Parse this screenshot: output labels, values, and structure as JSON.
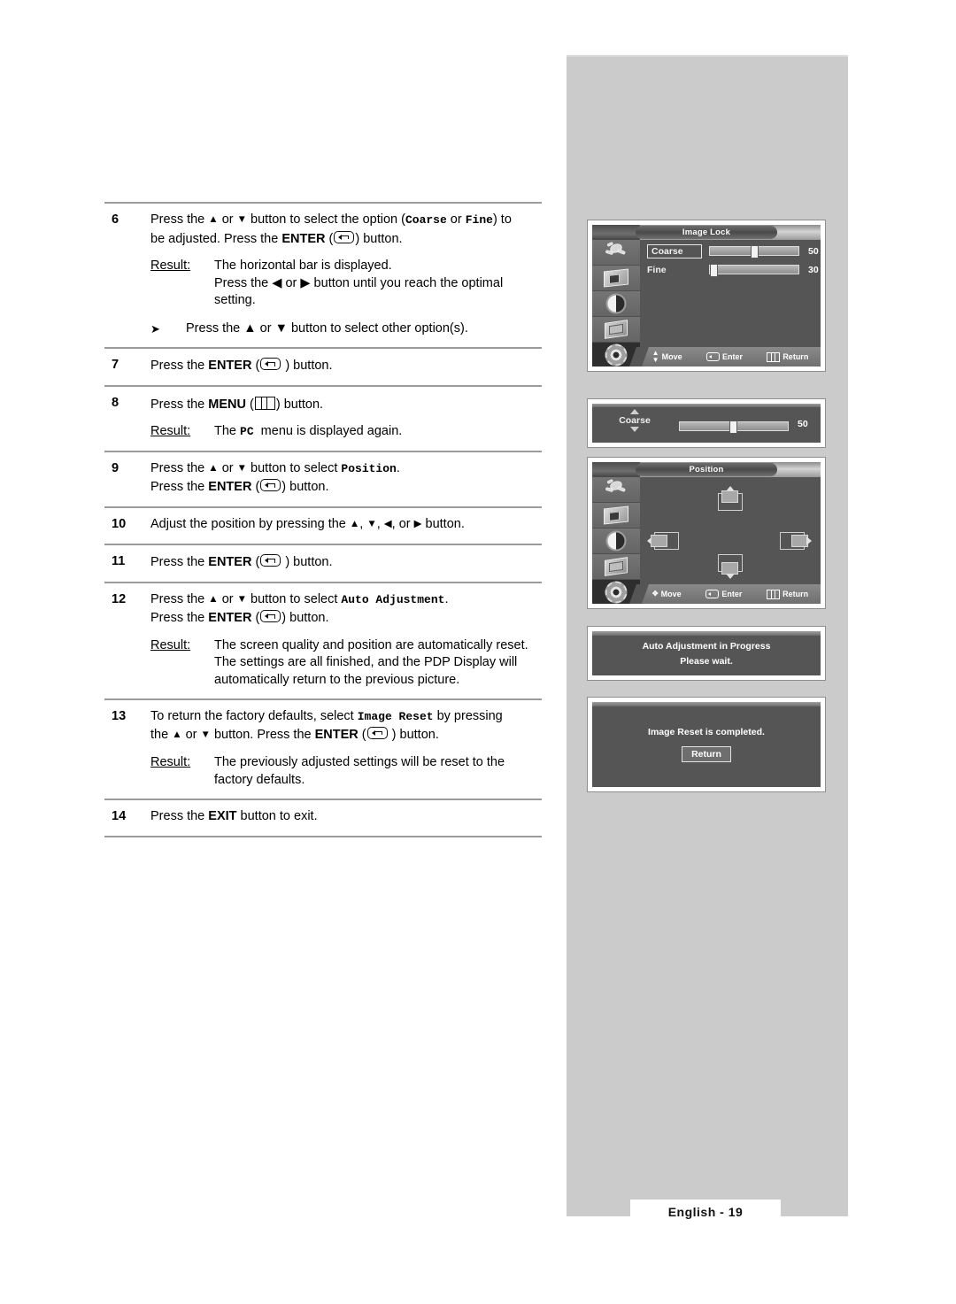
{
  "page": {
    "footer_label": "English - 19"
  },
  "steps": [
    {
      "num": "6",
      "lines": [
        {
          "parts": [
            {
              "t": "Press the "
            },
            {
              "t": "▲",
              "s": "arrow"
            },
            {
              "t": " or "
            },
            {
              "t": "▼",
              "s": "arrow"
            },
            {
              "t": " button to select the option ("
            },
            {
              "t": "Coarse",
              "s": "mono"
            },
            {
              "t": " or "
            },
            {
              "t": "Fine",
              "s": "mono"
            },
            {
              "t": ") to"
            }
          ]
        },
        {
          "parts": [
            {
              "t": "be adjusted. Press the "
            },
            {
              "t": "ENTER",
              "s": "bold"
            },
            {
              "t": " ("
            },
            {
              "t": "",
              "s": "enterkey"
            },
            {
              "t": ") button."
            }
          ]
        }
      ],
      "result_label": "Result:",
      "result_lines": [
        "The horizontal bar is displayed.",
        "Press the ◀ or ▶ button until you reach the optimal",
        "setting."
      ],
      "note": "Press the ▲ or ▼ button to select other option(s)."
    },
    {
      "num": "7",
      "lines": [
        {
          "parts": [
            {
              "t": "Press the "
            },
            {
              "t": "ENTER",
              "s": "bold"
            },
            {
              "t": " ("
            },
            {
              "t": "",
              "s": "enterkey"
            },
            {
              "t": " ) button."
            }
          ]
        }
      ]
    },
    {
      "num": "8",
      "lines": [
        {
          "parts": [
            {
              "t": "Press the "
            },
            {
              "t": "MENU",
              "s": "bold"
            },
            {
              "t": " ("
            },
            {
              "t": "",
              "s": "menukey"
            },
            {
              "t": ") button."
            }
          ]
        }
      ],
      "result_label": "Result:",
      "result_lines_rich": [
        {
          "parts": [
            {
              "t": "The "
            },
            {
              "t": "PC",
              "s": "mono"
            },
            {
              "t": "  menu is displayed again."
            }
          ]
        }
      ]
    },
    {
      "num": "9",
      "lines": [
        {
          "parts": [
            {
              "t": "Press the "
            },
            {
              "t": "▲",
              "s": "arrow"
            },
            {
              "t": " or "
            },
            {
              "t": "▼",
              "s": "arrow"
            },
            {
              "t": " button to select "
            },
            {
              "t": "Position",
              "s": "mono"
            },
            {
              "t": "."
            }
          ]
        },
        {
          "parts": [
            {
              "t": "Press the "
            },
            {
              "t": "ENTER",
              "s": "bold"
            },
            {
              "t": " ("
            },
            {
              "t": "",
              "s": "enterkey"
            },
            {
              "t": ") button."
            }
          ]
        }
      ]
    },
    {
      "num": "10",
      "lines": [
        {
          "parts": [
            {
              "t": "Adjust the position by pressing the "
            },
            {
              "t": "▲",
              "s": "arrow"
            },
            {
              "t": ", "
            },
            {
              "t": "▼",
              "s": "arrow"
            },
            {
              "t": ", "
            },
            {
              "t": "◀",
              "s": "arrow"
            },
            {
              "t": ", or "
            },
            {
              "t": "▶",
              "s": "arrow"
            },
            {
              "t": " button."
            }
          ]
        }
      ]
    },
    {
      "num": "11",
      "lines": [
        {
          "parts": [
            {
              "t": "Press the "
            },
            {
              "t": "ENTER",
              "s": "bold"
            },
            {
              "t": " ("
            },
            {
              "t": "",
              "s": "enterkey"
            },
            {
              "t": " ) button."
            }
          ]
        }
      ]
    },
    {
      "num": "12",
      "lines": [
        {
          "parts": [
            {
              "t": "Press the "
            },
            {
              "t": "▲",
              "s": "arrow"
            },
            {
              "t": " or "
            },
            {
              "t": "▼",
              "s": "arrow"
            },
            {
              "t": " button to select "
            },
            {
              "t": "Auto Adjustment",
              "s": "mono"
            },
            {
              "t": "."
            }
          ]
        },
        {
          "parts": [
            {
              "t": "Press the "
            },
            {
              "t": "ENTER",
              "s": "bold"
            },
            {
              "t": " ("
            },
            {
              "t": "",
              "s": "enterkey"
            },
            {
              "t": ") button."
            }
          ]
        }
      ],
      "result_label": "Result:",
      "result_lines": [
        "The screen quality and position are automatically reset.",
        "The settings are all finished, and the PDP Display will",
        "automatically return to the previous picture."
      ]
    },
    {
      "num": "13",
      "lines": [
        {
          "parts": [
            {
              "t": "To return the factory defaults, select "
            },
            {
              "t": "Image Reset",
              "s": "mono"
            },
            {
              "t": " by pressing"
            }
          ]
        },
        {
          "parts": [
            {
              "t": "the "
            },
            {
              "t": "▲",
              "s": "arrow"
            },
            {
              "t": " or "
            },
            {
              "t": "▼",
              "s": "arrow"
            },
            {
              "t": " button. Press the "
            },
            {
              "t": "ENTER",
              "s": "bold"
            },
            {
              "t": " ("
            },
            {
              "t": "",
              "s": "enterkey"
            },
            {
              "t": " ) button."
            }
          ]
        }
      ],
      "result_label": "Result:",
      "result_lines": [
        "The previously adjusted settings will be reset to the",
        "factory defaults."
      ]
    },
    {
      "num": "14",
      "lines": [
        {
          "parts": [
            {
              "t": "Press the "
            },
            {
              "t": "EXIT",
              "s": "bold"
            },
            {
              "t": " button to exit."
            }
          ]
        }
      ]
    }
  ],
  "osd": {
    "image_lock": {
      "title": "Image Lock",
      "rows": [
        {
          "label": "Coarse",
          "value": "50",
          "knob_pct": 50,
          "selected": true
        },
        {
          "label": "Fine",
          "value": "30",
          "knob_pct": 3,
          "selected": false
        }
      ],
      "help": {
        "move": "Move",
        "enter": "Enter",
        "return": "Return"
      },
      "rail_icons": [
        "input-plug-icon",
        "picture-icon",
        "sound-icon",
        "channel-icon",
        "setup-gear-icon"
      ],
      "rail_selected_index": 4
    },
    "coarse_bar": {
      "label": "Coarse",
      "value": "50",
      "knob_pct": 50
    },
    "position": {
      "title": "Position",
      "help": {
        "move": "Move",
        "enter": "Enter",
        "return": "Return"
      },
      "rail_icons": [
        "input-plug-icon",
        "picture-icon",
        "sound-icon",
        "channel-icon",
        "setup-gear-icon"
      ],
      "rail_selected_index": 4
    },
    "auto_adjustment": {
      "line1": "Auto Adjustment in Progress",
      "line2": "Please wait."
    },
    "image_reset": {
      "message": "Image Reset is completed.",
      "button": "Return"
    }
  }
}
